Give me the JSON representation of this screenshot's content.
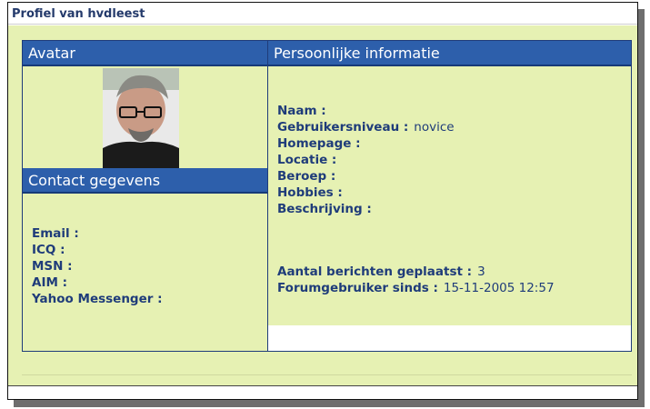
{
  "window": {
    "title": "Profiel van hvdleest"
  },
  "avatar_section": {
    "header": "Avatar"
  },
  "contact_section": {
    "header": "Contact gegevens",
    "fields": [
      {
        "label": "Email :",
        "value": ""
      },
      {
        "label": "ICQ :",
        "value": ""
      },
      {
        "label": "MSN :",
        "value": ""
      },
      {
        "label": "AIM :",
        "value": ""
      },
      {
        "label": "Yahoo Messenger :",
        "value": ""
      }
    ]
  },
  "personal_section": {
    "header": "Persoonlijke informatie",
    "fields": [
      {
        "label": "Naam :",
        "value": ""
      },
      {
        "label": "Gebruikersniveau :",
        "value": "novice"
      },
      {
        "label": "Homepage :",
        "value": ""
      },
      {
        "label": "Locatie :",
        "value": ""
      },
      {
        "label": "Beroep :",
        "value": ""
      },
      {
        "label": "Hobbies :",
        "value": ""
      },
      {
        "label": "Beschrijving :",
        "value": ""
      }
    ],
    "stats": [
      {
        "label": "Aantal berichten geplaatst :",
        "value": "3"
      },
      {
        "label": "Forumgebruiker sinds :",
        "value": "15-11-2005 12:57"
      }
    ]
  }
}
